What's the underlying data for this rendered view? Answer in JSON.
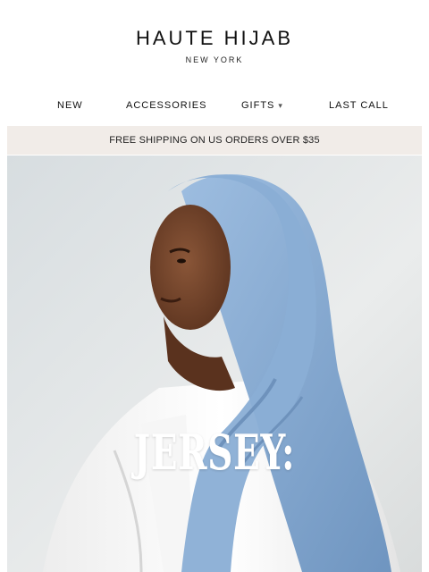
{
  "brand": {
    "name": "HAUTE HIJAB",
    "location": "NEW YORK"
  },
  "nav": {
    "items": [
      {
        "label": "NEW"
      },
      {
        "label": "ACCESSORIES"
      },
      {
        "label": "GIFTS",
        "icon": "chevron-down-icon"
      },
      {
        "label": "LAST CALL"
      }
    ]
  },
  "banner": {
    "text": "FREE SHIPPING ON US ORDERS OVER $35",
    "background": "#f1ece8"
  },
  "hero": {
    "title": "JERSEY:",
    "scarf_color": "#8fb2d6"
  }
}
